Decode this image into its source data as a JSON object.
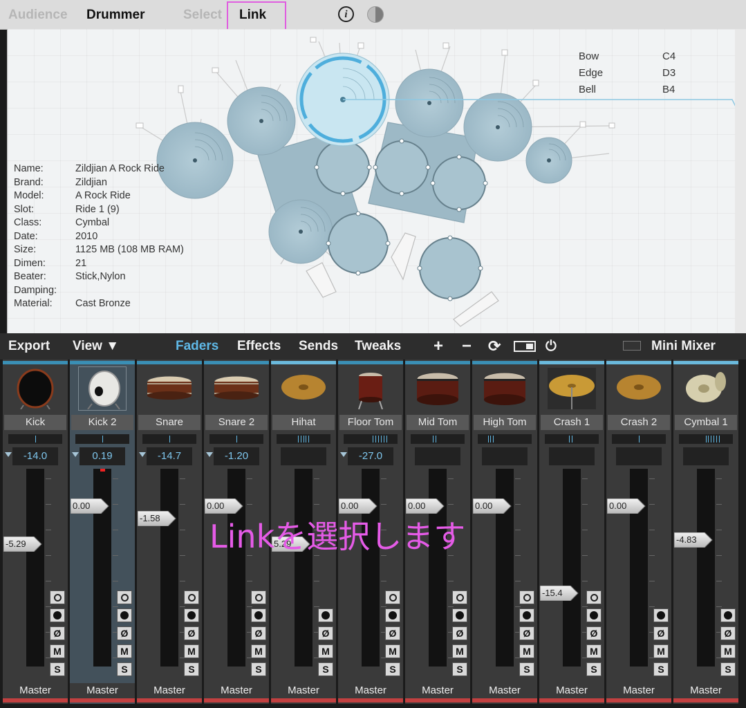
{
  "top_tabs": {
    "audience": "Audience",
    "drummer": "Drummer",
    "select": "Select",
    "link": "Link"
  },
  "info_glyph": "i",
  "zones": [
    {
      "name": "Bow",
      "note": "C4"
    },
    {
      "name": "Edge",
      "note": "D3"
    },
    {
      "name": "Bell",
      "note": "B4"
    }
  ],
  "properties": [
    {
      "key": "Name:",
      "value": "Zildjian A Rock Ride"
    },
    {
      "key": "Brand:",
      "value": "Zildjian"
    },
    {
      "key": "Model:",
      "value": "A Rock Ride"
    },
    {
      "key": "Slot:",
      "value": "Ride 1 (9)"
    },
    {
      "key": "Class:",
      "value": "Cymbal"
    },
    {
      "key": "Date:",
      "value": "2010"
    },
    {
      "key": "Size:",
      "value": "1125 MB (108 MB RAM)"
    },
    {
      "key": "Dimen:",
      "value": "21"
    },
    {
      "key": "Beater:",
      "value": "Stick,Nylon"
    },
    {
      "key": "Damping:",
      "value": ""
    },
    {
      "key": "Material:",
      "value": "Cast Bronze"
    }
  ],
  "mixer_toolbar": {
    "export": "Export",
    "view": "View ▼",
    "faders": "Faders",
    "effects": "Effects",
    "sends": "Sends",
    "tweaks": "Tweaks",
    "add": "+",
    "remove": "−",
    "refresh": "⟳",
    "power": "⏻",
    "mini_mixer": "Mini Mixer"
  },
  "colors": {
    "accent": "#5fb8e6",
    "highlight": "#e05ee0",
    "drum_fill": "#a7c3cf",
    "selected_ride": "#c9e6f1",
    "output_bar": "#c24040"
  },
  "channels": [
    {
      "name": "Kick",
      "icon": "kick-drum-icon",
      "type": "kick",
      "vol": "-14.0",
      "fader": "-5.29",
      "fader_level": 0.62,
      "pan": [
        0.5
      ],
      "top": "#3a8fb5",
      "o": true,
      "out": "Master"
    },
    {
      "name": "Kick 2",
      "icon": "kick-drum-2-icon",
      "type": "kick2",
      "vol": "0.19",
      "fader": "0.00",
      "fader_level": 0.81,
      "pan": [
        0.5
      ],
      "top": "#3a8fb5",
      "o": true,
      "out": "Master",
      "selected": true,
      "red": true
    },
    {
      "name": "Snare",
      "icon": "snare-drum-icon",
      "type": "snare",
      "vol": "-14.7",
      "fader": "-1.58",
      "fader_level": 0.75,
      "pan": [
        0.5
      ],
      "top": "#3a8fb5",
      "o": true,
      "out": "Master"
    },
    {
      "name": "Snare 2",
      "icon": "snare-drum-2-icon",
      "type": "snare",
      "vol": "-1.20",
      "fader": "0.00",
      "fader_level": 0.81,
      "pan": [
        0.5
      ],
      "top": "#3a8fb5",
      "o": true,
      "out": "Master"
    },
    {
      "name": "Hihat",
      "icon": "hihat-icon",
      "type": "cym",
      "vol": "",
      "fader": "5.29",
      "fader_level": 0.62,
      "pan": [
        0.4,
        0.45,
        0.5,
        0.55,
        0.6
      ],
      "top": "#6ab9dc",
      "o": false,
      "out": "Master"
    },
    {
      "name": "Floor Tom",
      "icon": "floor-tom-icon",
      "type": "floortom",
      "vol": "-27.0",
      "fader": "0.00",
      "fader_level": 0.81,
      "pan": [
        0.55,
        0.6,
        0.65,
        0.7,
        0.75,
        0.8
      ],
      "top": "#3a8fb5",
      "o": true,
      "out": "Master"
    },
    {
      "name": "Mid Tom",
      "icon": "mid-tom-icon",
      "type": "tom",
      "vol": "",
      "fader": "0.00",
      "fader_level": 0.81,
      "pan": [
        0.42,
        0.47
      ],
      "top": "#3a8fb5",
      "o": true,
      "out": "Master"
    },
    {
      "name": "High Tom",
      "icon": "high-tom-icon",
      "type": "tom",
      "vol": "",
      "fader": "0.00",
      "fader_level": 0.81,
      "pan": [
        0.2,
        0.24,
        0.28
      ],
      "top": "#3a8fb5",
      "o": true,
      "out": "Master"
    },
    {
      "name": "Crash 1",
      "icon": "crash-1-icon",
      "type": "crash",
      "vol": "",
      "fader": "-15.4",
      "fader_level": 0.37,
      "pan": [
        0.45,
        0.5
      ],
      "top": "#6ab9dc",
      "o": true,
      "out": "Master"
    },
    {
      "name": "Crash 2",
      "icon": "crash-2-icon",
      "type": "cym",
      "vol": "",
      "fader": "0.00",
      "fader_level": 0.81,
      "pan": [
        0.5
      ],
      "top": "#6ab9dc",
      "o": false,
      "out": "Master"
    },
    {
      "name": "Cymbal 1",
      "icon": "cymbal-1-icon",
      "type": "china",
      "vol": "",
      "fader": "-4.83",
      "fader_level": 0.64,
      "pan": [
        0.5,
        0.55,
        0.6,
        0.65,
        0.7,
        0.75
      ],
      "top": "#6ab9dc",
      "o": false,
      "out": "Master"
    }
  ],
  "button_labels": {
    "phase": "Ø",
    "mute": "M",
    "solo": "S"
  },
  "overlay_text": "Linkを選択します"
}
